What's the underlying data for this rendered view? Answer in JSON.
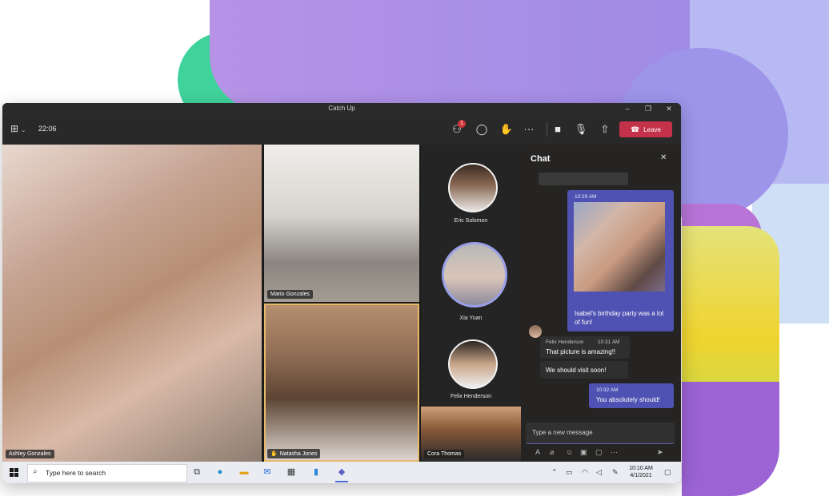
{
  "window": {
    "title": "Catch Up"
  },
  "toolbar": {
    "time": "22:06",
    "participants_badge": "1",
    "leave_label": "Leave"
  },
  "participants": {
    "main": "Ashley Gonzales",
    "mario": "Mario Gonzales",
    "natasha": "Natasha Jones",
    "cora": "Cora Thomas",
    "side": [
      "Eric Solomon",
      "Xia Yuan",
      "Felix Henderson"
    ]
  },
  "chat": {
    "title": "Chat",
    "messages": [
      {
        "time": "10:29 AM",
        "text": "Isabel's birthday party was a lot of fun!"
      },
      {
        "sender": "Felix Henderson",
        "time": "10:31 AM",
        "text": "That picture is amazing!!"
      },
      {
        "text": "We should visit soon!"
      },
      {
        "time": "10:32 AM",
        "text": "You absolutely should!"
      }
    ],
    "compose_placeholder": "Type a new message"
  },
  "taskbar": {
    "search_placeholder": "Type here to search",
    "time": "10:10 AM",
    "date": "4/1/2021"
  }
}
